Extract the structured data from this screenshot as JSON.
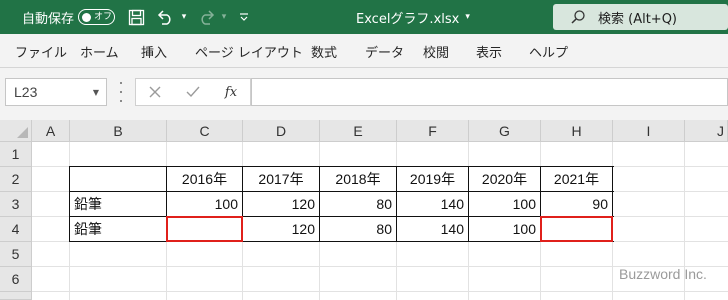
{
  "titlebar": {
    "autosave_label": "自動保存",
    "autosave_state": "オフ",
    "file_name": "Excelグラフ.xlsx",
    "search_text": "検索 (Alt+Q)",
    "bg_color": "#217346"
  },
  "ribbon": {
    "tabs": [
      "ファイル",
      "ホーム",
      "挿入",
      "ページ レイアウト",
      "数式",
      "データ",
      "校閲",
      "表示",
      "ヘルプ"
    ]
  },
  "formula_bar": {
    "name_box": "L23",
    "fx_label": "fx",
    "formula": ""
  },
  "sheet": {
    "columns": [
      "A",
      "B",
      "C",
      "D",
      "E",
      "F",
      "G",
      "H",
      "I",
      "J"
    ],
    "rows": [
      "1",
      "2",
      "3",
      "4",
      "5",
      "6",
      "7"
    ],
    "years": [
      "2016年",
      "2017年",
      "2018年",
      "2019年",
      "2020年",
      "2021年"
    ],
    "data_rows": [
      {
        "label": "鉛筆",
        "values": [
          "100",
          "120",
          "80",
          "140",
          "100",
          "90"
        ]
      },
      {
        "label": "鉛筆",
        "values": [
          "",
          "120",
          "80",
          "140",
          "100",
          ""
        ]
      }
    ],
    "highlighted_cells": [
      "C4",
      "H4"
    ],
    "highlight_color": "#e0201b"
  },
  "watermark": "Buzzword Inc."
}
